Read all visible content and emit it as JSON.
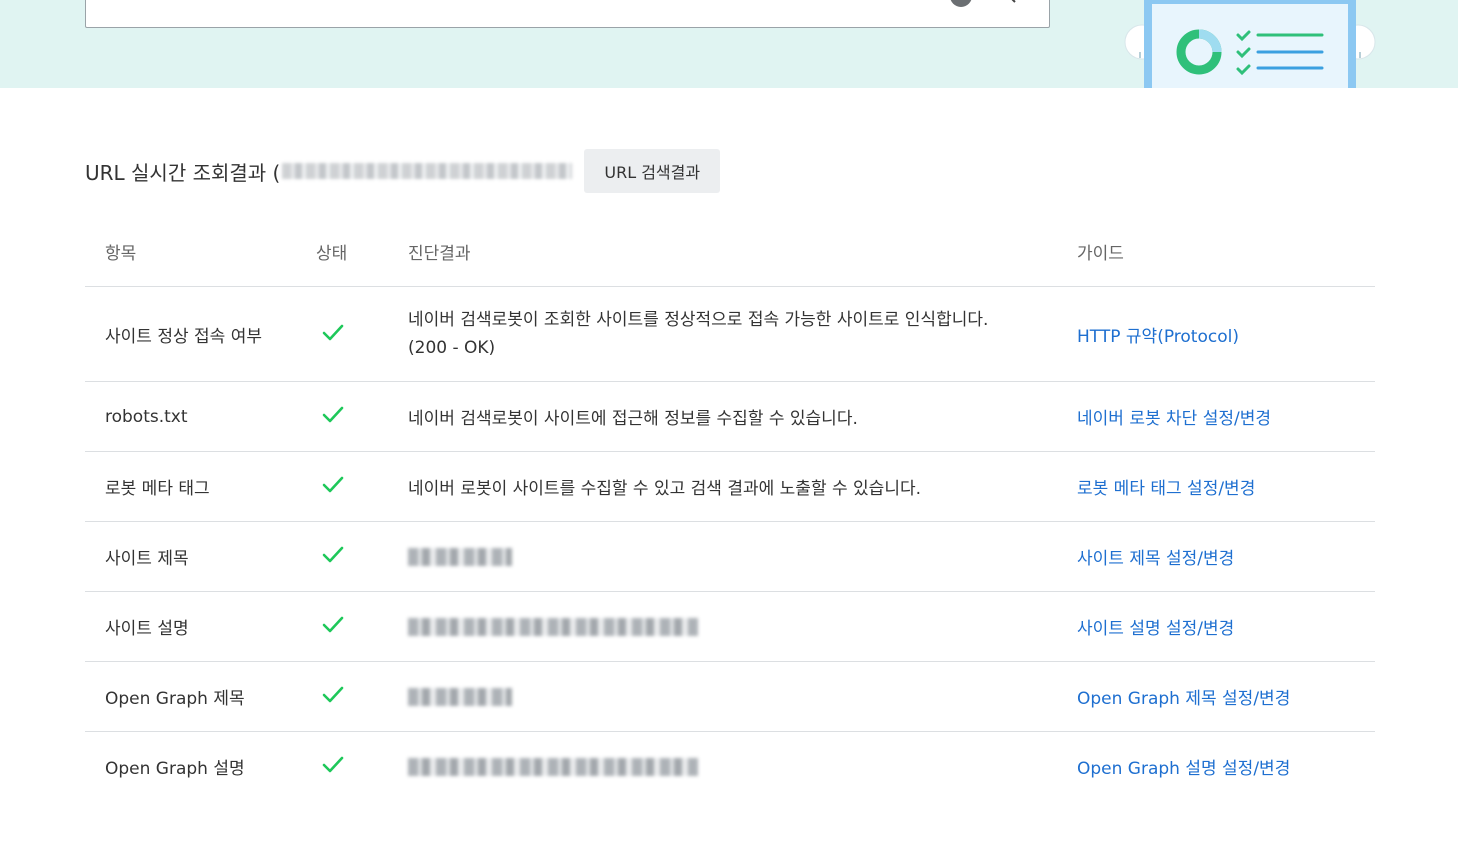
{
  "search": {
    "value": "",
    "placeholder": ""
  },
  "result": {
    "title": "URL 실시간 조회결과 (",
    "url_search_button": "URL 검색결과"
  },
  "table": {
    "headers": {
      "item": "항목",
      "status": "상태",
      "result": "진단결과",
      "guide": "가이드"
    },
    "rows": [
      {
        "item": "사이트 정상 접속 여부",
        "status": "ok",
        "result": "네이버 검색로봇이 조회한 사이트를 정상적으로 접속 가능한 사이트로 인식합니다.",
        "result_sub": "(200 - OK)",
        "guide": "HTTP 규약(Protocol)"
      },
      {
        "item": "robots.txt",
        "status": "ok",
        "result": "네이버 검색로봇이 사이트에 접근해 정보를 수집할 수 있습니다.",
        "guide": "네이버 로봇 차단 설정/변경"
      },
      {
        "item": "로봇 메타 태그",
        "status": "ok",
        "result": "네이버 로봇이 사이트를 수집할 수 있고 검색 결과에 노출할 수 있습니다.",
        "guide": "로봇 메타 태그 설정/변경"
      },
      {
        "item": "사이트 제목",
        "status": "ok",
        "result": "",
        "guide": "사이트 제목 설정/변경"
      },
      {
        "item": "사이트 설명",
        "status": "ok",
        "result": "",
        "guide": "사이트 설명 설정/변경"
      },
      {
        "item": "Open Graph 제목",
        "status": "ok",
        "result": "",
        "guide": "Open Graph 제목 설정/변경"
      },
      {
        "item": "Open Graph 설명",
        "status": "ok",
        "result": "",
        "guide": "Open Graph 설명 설정/변경"
      }
    ]
  },
  "icons": {
    "check": "check-icon",
    "clear": "clear-icon",
    "search": "search-icon"
  },
  "colors": {
    "hero_bg": "#e0f4f2",
    "check": "#1ec85a",
    "link": "#1e6fd0",
    "button_bg": "#eceef0"
  }
}
